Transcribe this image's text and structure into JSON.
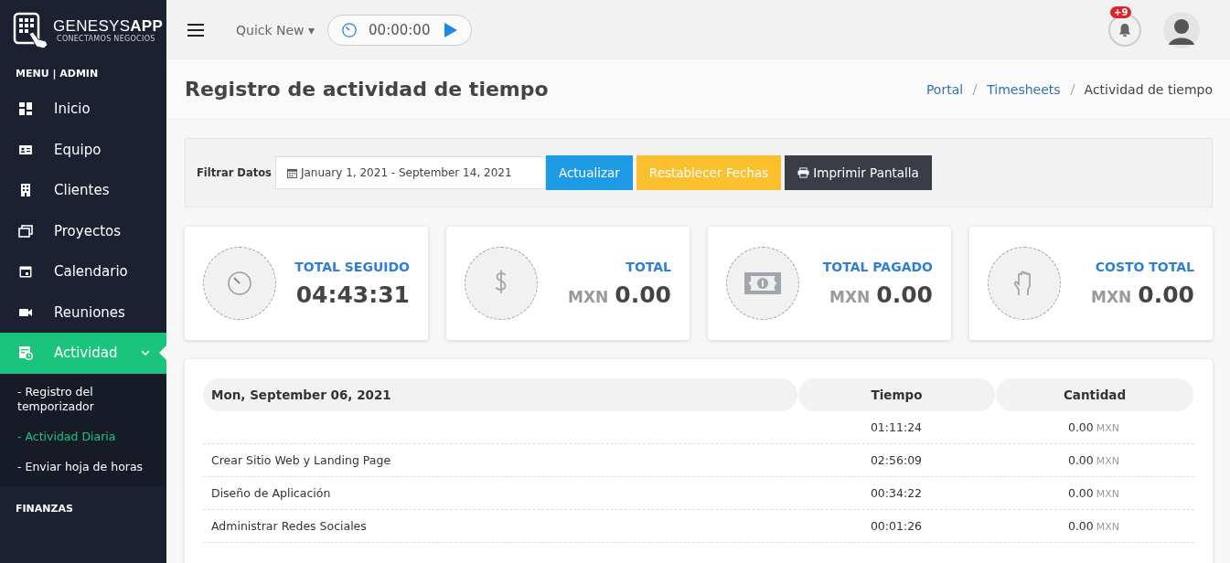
{
  "brand": {
    "name": "GENESYS**APP**",
    "tagline": "CONECTAMOS NEGOCIOS"
  },
  "sidebar": {
    "sections": [
      {
        "title": "MENU | ADMIN",
        "items": [
          {
            "label": "Inicio",
            "selected": false
          },
          {
            "label": "Equipo",
            "selected": false
          },
          {
            "label": "Clientes",
            "selected": false
          },
          {
            "label": "Proyectos",
            "selected": false
          },
          {
            "label": "Calendario",
            "selected": false
          },
          {
            "label": "Reuniones",
            "selected": false
          },
          {
            "label": "Actividad",
            "selected": true,
            "expanded": true,
            "children": [
              {
                "label": "- Registro del temporizador",
                "selected": false
              },
              {
                "label": "- Actividad Diaria",
                "selected": true
              },
              {
                "label": "- Enviar hoja de horas",
                "selected": false
              }
            ]
          }
        ]
      },
      {
        "title": "FINANZAS"
      }
    ]
  },
  "topbar": {
    "quick_new": "Quick New",
    "caret": "▾",
    "timer": "00:00:00",
    "notifications": "+9"
  },
  "page": {
    "title": "Registro de actividad de tiempo",
    "breadcrumb": [
      {
        "label": "Portal",
        "link": true
      },
      {
        "label": "Timesheets",
        "link": true
      },
      {
        "label": "Actividad de tiempo",
        "link": false
      }
    ]
  },
  "filter": {
    "label": "Filtrar Datos",
    "date_range": "January 1, 2021 - September 14, 2021",
    "buttons": [
      {
        "label": "Actualizar",
        "kind": "primary"
      },
      {
        "label": "Restablecer Fechas",
        "kind": "warning"
      },
      {
        "label": "Imprimir Pantalla",
        "kind": "dark"
      }
    ]
  },
  "stats": [
    {
      "title": "TOTAL SEGUIDO",
      "value": "04:43:31"
    },
    {
      "title": "TOTAL",
      "currency": "MXN",
      "value": "0.00"
    },
    {
      "title": "TOTAL PAGADO",
      "currency": "MXN",
      "value": "0.00"
    },
    {
      "title": "COSTO TOTAL",
      "currency": "MXN",
      "value": "0.00"
    }
  ],
  "table": {
    "columns": [
      "Mon, September 06, 2021",
      "Tiempo",
      "Cantidad"
    ],
    "rows": [
      {
        "time": "01:11:24",
        "amount": "0.00",
        "currency": "MXN"
      },
      {
        "name": "Crear Sitio Web y Landing Page",
        "time": "02:56:09",
        "amount": "0.00",
        "currency": "MXN"
      },
      {
        "name": "Diseño de Aplicación",
        "time": "00:34:22",
        "amount": "0.00",
        "currency": "MXN"
      },
      {
        "name": "Administrar Redes Sociales",
        "time": "00:01:26",
        "amount": "0.00",
        "currency": "MXN"
      }
    ]
  }
}
